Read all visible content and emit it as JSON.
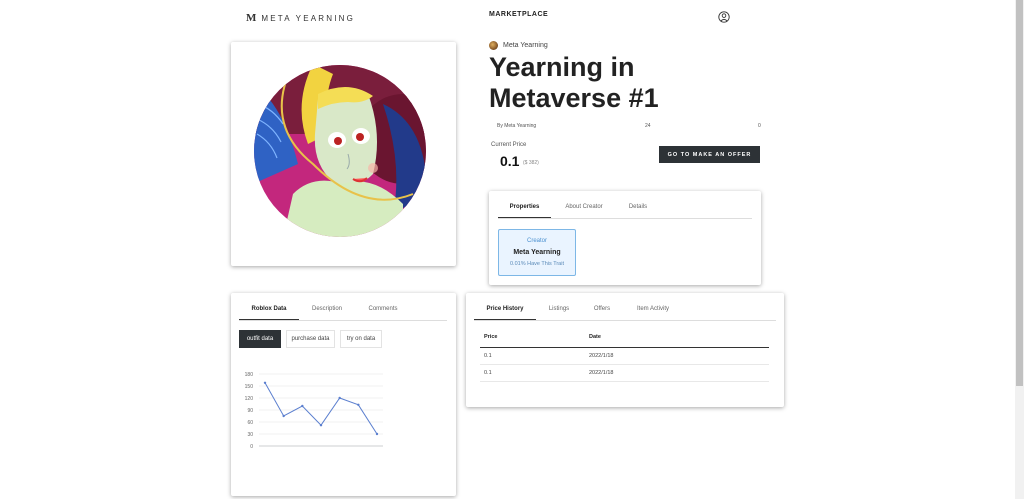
{
  "header": {
    "logo_mark": "M",
    "logo_text": "META YEARNING",
    "nav_marketplace": "MARKETPLACE",
    "icons": {
      "user": "user-account-icon"
    }
  },
  "item": {
    "owner_name": "Meta Yearning",
    "title": "Yearning in Metaverse #1",
    "by_label": "By Meta Yearning",
    "stat_a": "24",
    "stat_b": "0",
    "price_label": "Current Price",
    "price_value": "0.1",
    "price_usd": "($ 382)",
    "offer_button": "GO TO MAKE AN OFFER"
  },
  "properties_panel": {
    "tabs": [
      "Properties",
      "About Creator",
      "Details"
    ],
    "active_tab": "Properties",
    "trait": {
      "type": "Creator",
      "value": "Meta Yearning",
      "rarity": "0.01% Have This Trait"
    }
  },
  "roblox_panel": {
    "tabs": [
      "Roblox Data",
      "Description",
      "Comments"
    ],
    "active_tab": "Roblox Data",
    "segments": [
      "outfit data",
      "purchase data",
      "try on data"
    ],
    "active_segment": "outfit data"
  },
  "history_panel": {
    "tabs": [
      "Price History",
      "Listings",
      "Offers",
      "Item Activity"
    ],
    "active_tab": "Price History",
    "columns": [
      "Price",
      "Date"
    ],
    "rows": [
      {
        "price": "0.1",
        "date": "2022/1/18"
      },
      {
        "price": "0.1",
        "date": "2022/1/18"
      }
    ]
  },
  "chart_data": {
    "type": "line",
    "title": "",
    "xlabel": "",
    "ylabel": "",
    "ylim": [
      0,
      180
    ],
    "yticks": [
      0,
      30,
      60,
      90,
      120,
      150,
      180
    ],
    "grid": true,
    "series": [
      {
        "values": [
          158,
          75,
          100,
          52,
          120,
          103,
          30
        ],
        "color": "#5b7fcf"
      }
    ]
  }
}
